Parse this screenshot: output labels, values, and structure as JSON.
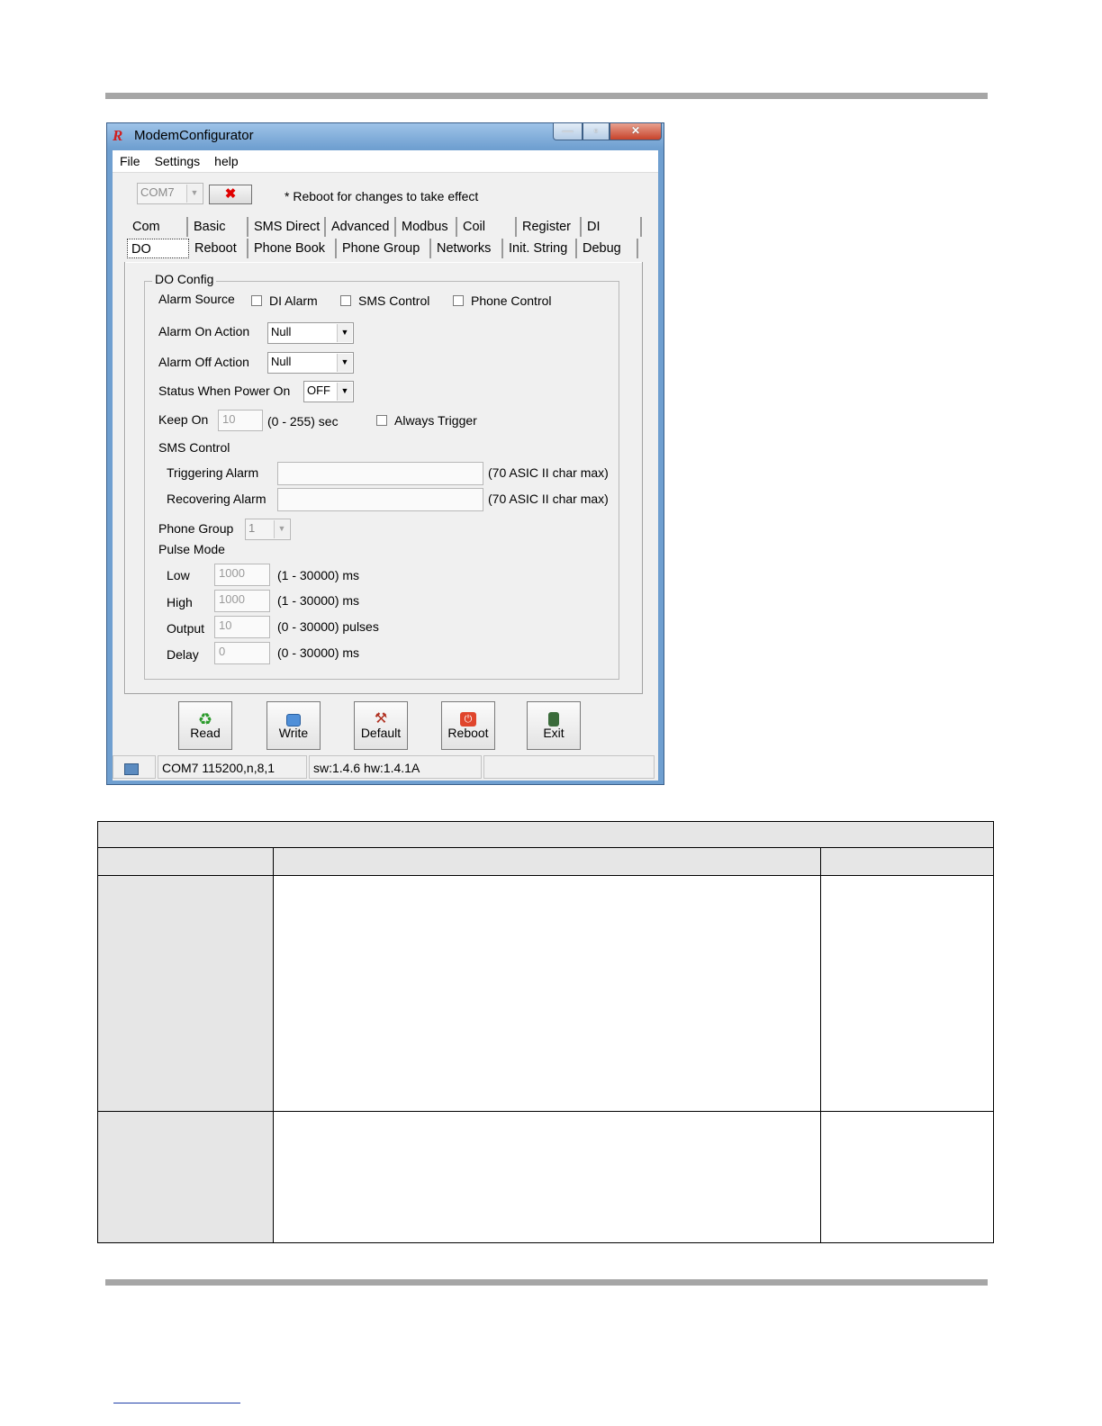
{
  "window": {
    "title": "ModemConfigurator",
    "app_icon": "R"
  },
  "menu": [
    "File",
    "Settings",
    "help"
  ],
  "toolbar": {
    "port_value": "COM7",
    "close_symbol": "✖",
    "note": "* Reboot for changes to take effect"
  },
  "tabs": {
    "row1": [
      "Com",
      "Basic",
      "SMS Direct",
      "Advanced",
      "Modbus",
      "Coil",
      "Register",
      "DI"
    ],
    "row2": [
      "DO",
      "Reboot",
      "Phone Book",
      "Phone Group",
      "Networks",
      "Init. String",
      "Debug"
    ],
    "active": "DO"
  },
  "do_config": {
    "title": "DO Config",
    "alarm_source_label": "Alarm Source",
    "alarm_sources": [
      "DI Alarm",
      "SMS Control",
      "Phone Control"
    ],
    "alarm_on_label": "Alarm On Action",
    "alarm_on_value": "Null",
    "alarm_off_label": "Alarm Off Action",
    "alarm_off_value": "Null",
    "power_on_label": "Status When Power On",
    "power_on_value": "OFF",
    "keep_on_label": "Keep On",
    "keep_on_value": "10",
    "keep_on_range": "(0 - 255) sec",
    "always_trigger_label": "Always Trigger",
    "sms_control_label": "SMS Control",
    "triggering_label": "Triggering Alarm",
    "triggering_hint": "(70 ASIC II char max)",
    "recovering_label": "Recovering Alarm",
    "recovering_hint": "(70 ASIC II char max)",
    "phone_group_label": "Phone Group",
    "phone_group_value": "1",
    "pulse_mode_label": "Pulse Mode",
    "pulse": {
      "low_label": "Low",
      "low_value": "1000",
      "low_range": "(1 - 30000) ms",
      "high_label": "High",
      "high_value": "1000",
      "high_range": "(1 - 30000) ms",
      "output_label": "Output",
      "output_value": "10",
      "output_range": "(0 - 30000) pulses",
      "delay_label": "Delay",
      "delay_value": "0",
      "delay_range": "(0 - 30000) ms"
    }
  },
  "buttons": {
    "read": "Read",
    "write": "Write",
    "default": "Default",
    "reboot": "Reboot",
    "exit": "Exit"
  },
  "status": {
    "port": "COM7 115200,n,8,1",
    "version": "sw:1.4.6 hw:1.4.1A"
  }
}
